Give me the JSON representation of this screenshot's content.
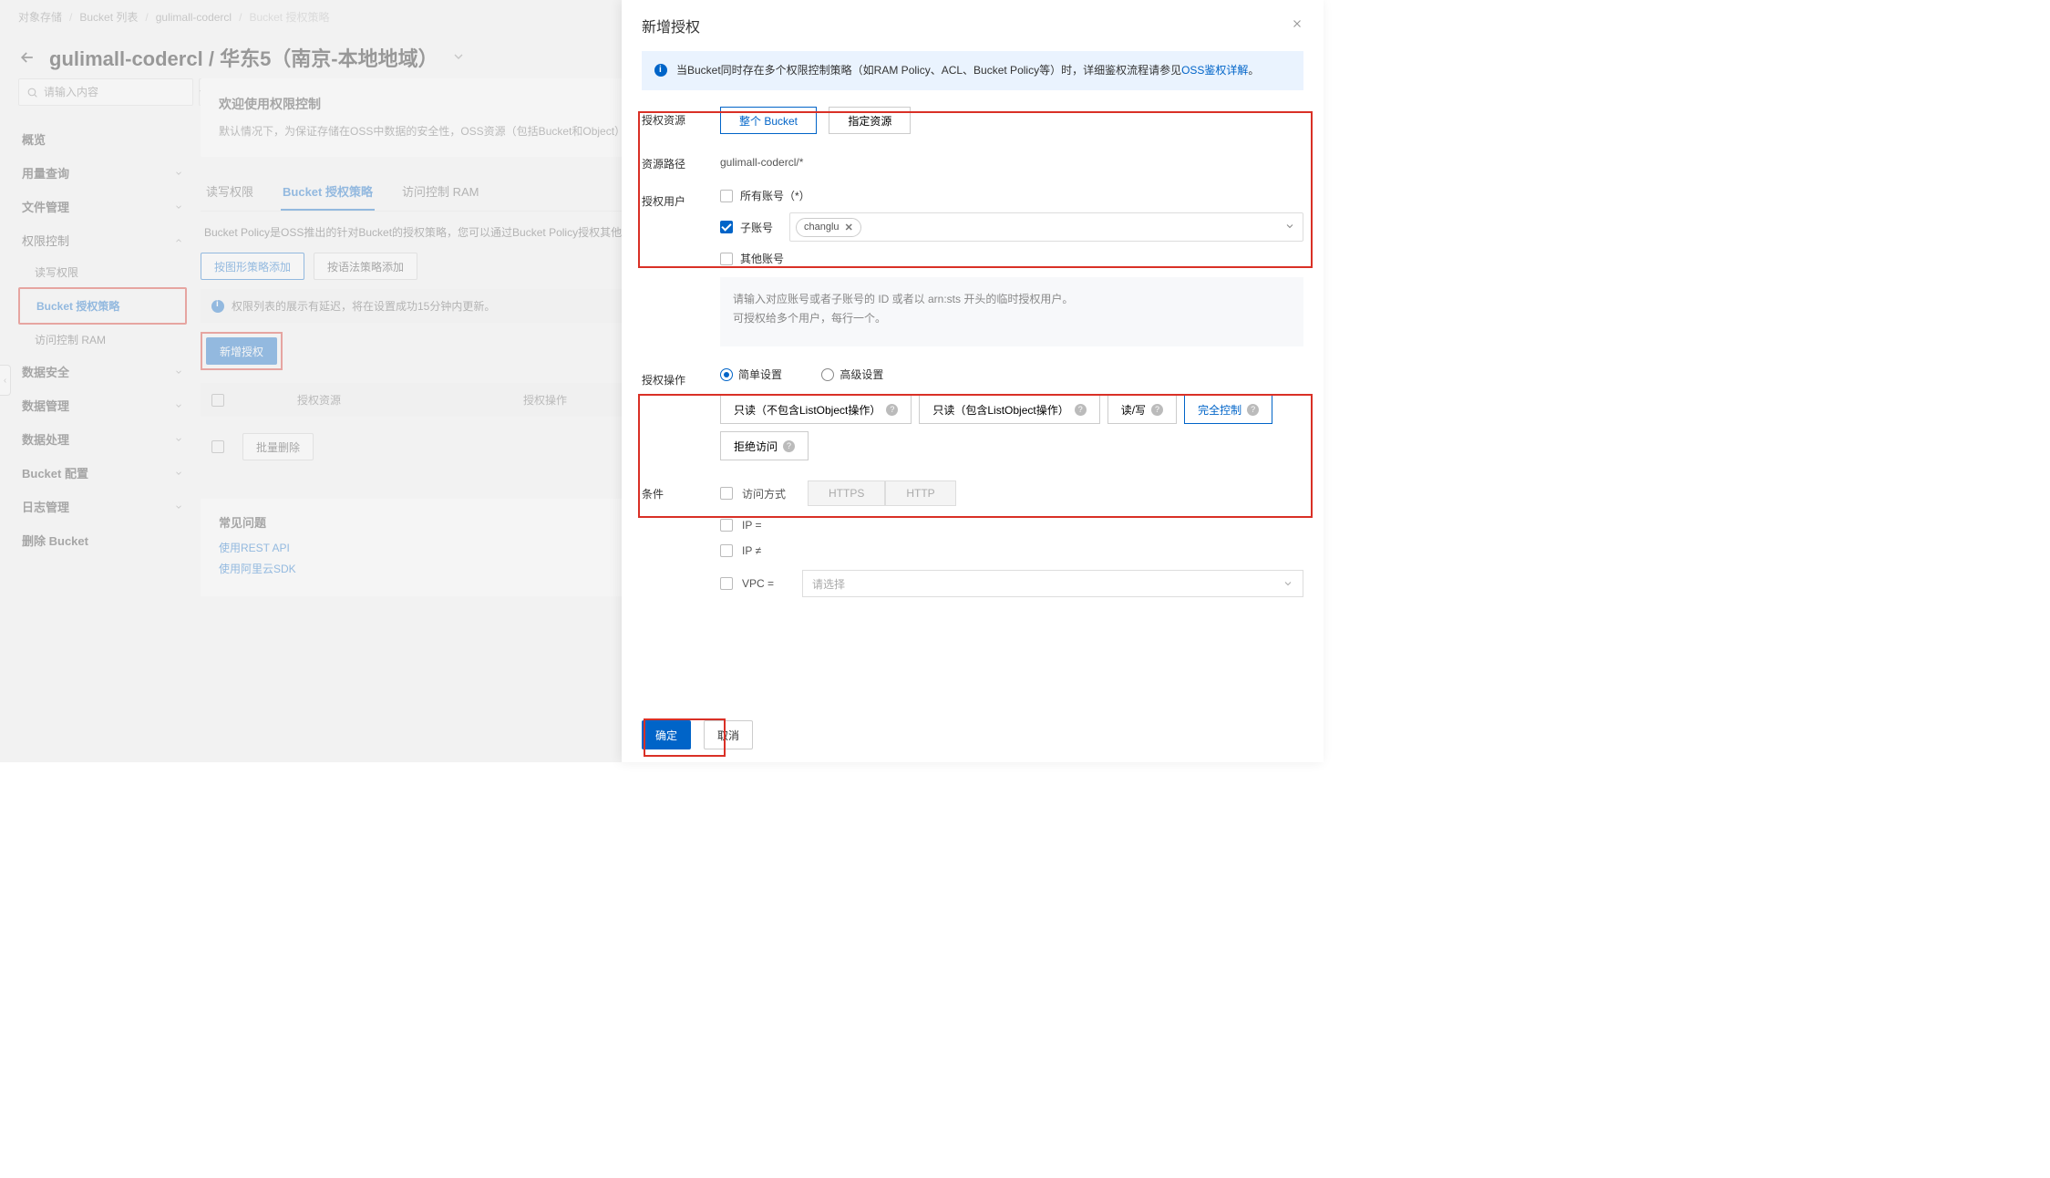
{
  "crumbs": {
    "a": "对象存储",
    "b": "Bucket 列表",
    "c": "gulimall-codercl",
    "d": "Bucket 授权策略"
  },
  "title": {
    "bucket": "gulimall-codercl",
    "region": "华东5（南京-本地地域）"
  },
  "search": {
    "placeholder": "请输入内容"
  },
  "nav": {
    "overview": "概览",
    "usage": "用量查询",
    "files": "文件管理",
    "perm": "权限控制",
    "perm_rw": "读写权限",
    "perm_policy": "Bucket 授权策略",
    "perm_ram": "访问控制 RAM",
    "security": "数据安全",
    "datamgmt": "数据管理",
    "process": "数据处理",
    "config": "Bucket 配置",
    "log": "日志管理",
    "delete": "删除 Bucket"
  },
  "panel": {
    "welcome_title": "欢迎使用权限控制",
    "welcome_body": "默认情况下，为保证存储在OSS中数据的安全性，OSS资源（包括Bucket和Object）默认为私有权限，只有资源拥有者才能访问。如需授权他人访问，可通过权限控制策略向他人授予资源的特定权限。",
    "tabs": {
      "rw": "读写权限",
      "policy": "Bucket 授权策略",
      "ram": "访问控制 RAM"
    },
    "policy_desc": "Bucket Policy是OSS推出的针对Bucket的授权策略，您可以通过Bucket Policy授权其他用户访问您的OSS资源。",
    "add_graph": "按图形策略添加",
    "add_syntax": "按语法策略添加",
    "delay_note": "权限列表的展示有延迟，将在设置成功15分钟内更新。",
    "new_auth": "新增授权",
    "th_resource": "授权资源",
    "th_op": "授权操作",
    "bulk_delete": "批量删除",
    "faq_title": "常见问题",
    "faq1": "使用REST API",
    "faq2": "使用阿里云SDK"
  },
  "drawer": {
    "title": "新增授权",
    "alert_pre": "当Bucket同时存在多个权限控制策略（如RAM Policy、ACL、Bucket Policy等）时，详细鉴权流程请参见",
    "alert_link": "OSS鉴权详解",
    "alert_post": "。",
    "f_resource": "授权资源",
    "btn_whole": "整个 Bucket",
    "btn_spec": "指定资源",
    "f_path": "资源路径",
    "path_val": "gulimall-codercl/*",
    "f_user": "授权用户",
    "u_all": "所有账号（*）",
    "u_sub": "子账号",
    "u_other": "其他账号",
    "tag_user": "changlu",
    "hint1": "请输入对应账号或者子账号的 ID 或者以 arn:sts 开头的临时授权用户。",
    "hint2": "可授权给多个用户，每行一个。",
    "f_op": "授权操作",
    "r_simple": "简单设置",
    "r_adv": "高级设置",
    "op1": "只读（不包含ListObject操作）",
    "op2": "只读（包含ListObject操作）",
    "op3": "读/写",
    "op4": "完全控制",
    "op5": "拒绝访问",
    "f_cond": "条件",
    "c_method": "访问方式",
    "c_https": "HTTPS",
    "c_http": "HTTP",
    "c_ipeq": "IP =",
    "c_ipne": "IP ≠",
    "c_vpc": "VPC =",
    "c_placeholder": "请选择",
    "ok": "确定",
    "cancel": "取消"
  }
}
